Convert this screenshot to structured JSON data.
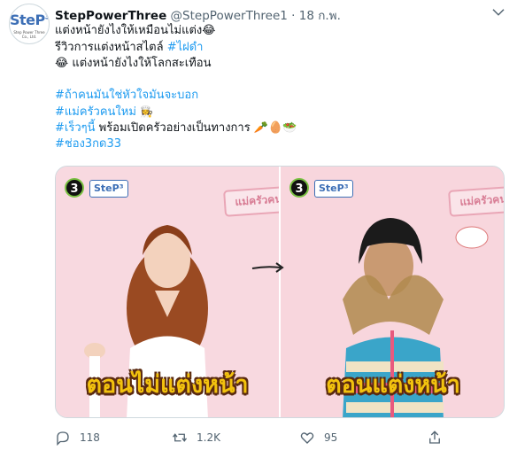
{
  "tweet": {
    "display_name": "StepPowerThree",
    "handle": "@StepPowerThree1",
    "separator": "·",
    "time": "18 ก.พ.",
    "avatar": {
      "logo_text": "SteP",
      "logo_sup": "3",
      "logo_subtext": "Step Power Three Co., Ltd."
    },
    "text": {
      "line1": "แต่งหน้ายังไงให้เหมือนไม่แต่ง😂",
      "line2_prefix": "รีวิวการแต่งหน้าสไตล์ ",
      "line2_tag": "#ไฝดำ",
      "line3": "😂 แต่งหน้ายังไงให้โลกสะเทือน",
      "tag1": "#ถ้าคนมันใช่หัวใจมันจะบอก",
      "tag2": "#แม่ครัวคนใหม่",
      "tag2_emoji": "👩‍🍳",
      "tag3": "#เร็วๆนี้",
      "line_after_tag3": " พร้อมเปิดครัวอย่างเป็นทางการ 🥕🥚🥗",
      "tag4": "#ช่อง3กด33"
    },
    "media": {
      "left": {
        "channel_logo": "3",
        "step_logo": "SteP³",
        "stamp": "แม่ครัวคนใ",
        "caption": "ตอนไม่แต่งหน้า"
      },
      "right": {
        "channel_logo": "3",
        "step_logo": "SteP³",
        "stamp": "แม่ครัวคนใ",
        "caption": "ตอนแต่งหน้า"
      }
    },
    "actions": {
      "replies": "118",
      "retweets": "1.2K",
      "likes": "95"
    }
  },
  "colors": {
    "accent": "#1d9bf0",
    "muted": "#536471",
    "caption_yellow": "#f2c20e",
    "panel_pink": "#f8d9e0"
  }
}
